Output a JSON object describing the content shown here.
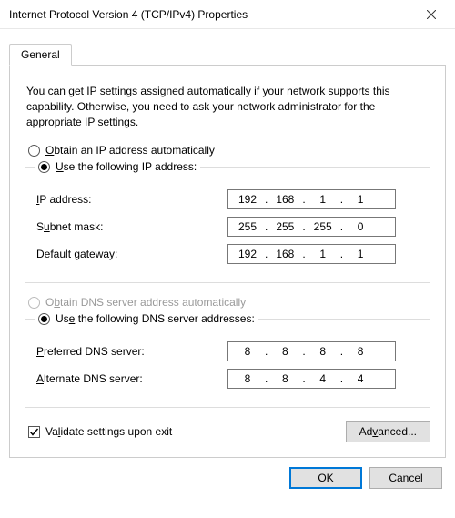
{
  "window": {
    "title": "Internet Protocol Version 4 (TCP/IPv4) Properties"
  },
  "tabs": {
    "general": "General"
  },
  "intro": "You can get IP settings assigned automatically if your network supports this capability. Otherwise, you need to ask your network administrator for the appropriate IP settings.",
  "ip": {
    "auto_label": "Obtain an IP address automatically",
    "manual_label": "Use the following IP address:",
    "mode": "manual",
    "address_label": "IP address:",
    "subnet_label": "Subnet mask:",
    "gateway_label": "Default gateway:",
    "address": [
      "192",
      "168",
      "1",
      "1"
    ],
    "subnet": [
      "255",
      "255",
      "255",
      "0"
    ],
    "gateway": [
      "192",
      "168",
      "1",
      "1"
    ]
  },
  "dns": {
    "auto_label": "Obtain DNS server address automatically",
    "manual_label": "Use the following DNS server addresses:",
    "auto_enabled": false,
    "mode": "manual",
    "preferred_label": "Preferred DNS server:",
    "alternate_label": "Alternate DNS server:",
    "preferred": [
      "8",
      "8",
      "8",
      "8"
    ],
    "alternate": [
      "8",
      "8",
      "4",
      "4"
    ]
  },
  "validate": {
    "label": "Validate settings upon exit",
    "checked": true
  },
  "buttons": {
    "advanced": "Advanced...",
    "ok": "OK",
    "cancel": "Cancel"
  }
}
